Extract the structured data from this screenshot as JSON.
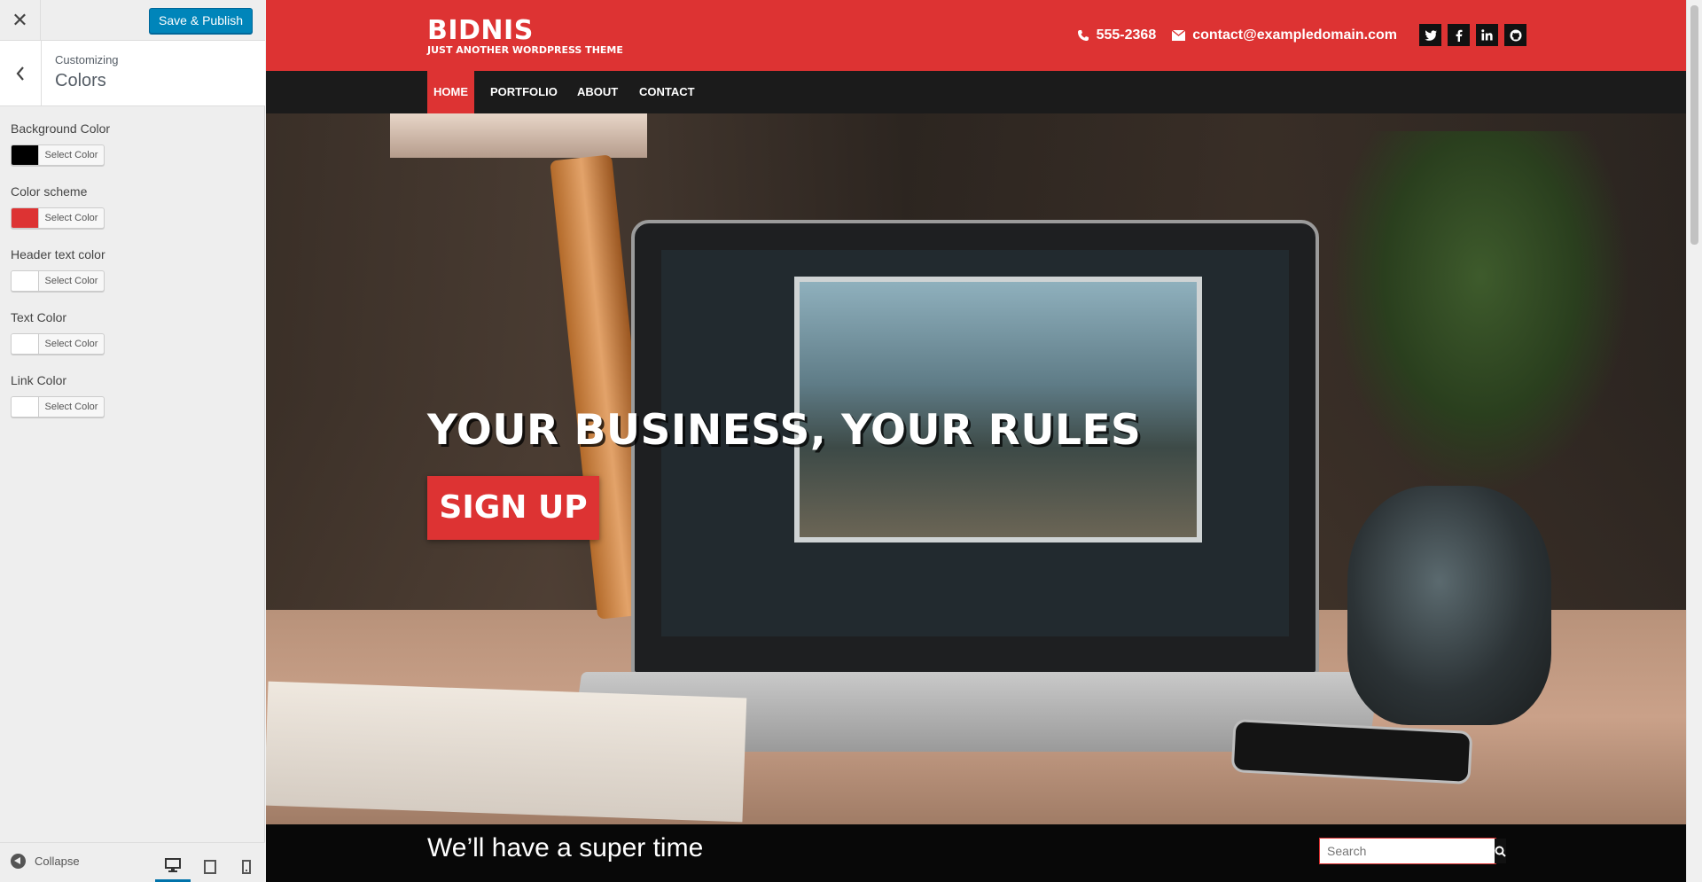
{
  "customizer": {
    "close_icon": "close-icon",
    "save_label": "Save & Publish",
    "customizing_label": "Customizing",
    "section_name": "Colors",
    "controls": [
      {
        "label": "Background Color",
        "color": "#000000",
        "button": "Select Color"
      },
      {
        "label": "Color scheme",
        "color": "#dd3333",
        "button": "Select Color"
      },
      {
        "label": "Header text color",
        "color": "#ffffff",
        "button": "Select Color"
      },
      {
        "label": "Text Color",
        "color": "#ffffff",
        "button": "Select Color"
      },
      {
        "label": "Link Color",
        "color": "#ffffff",
        "button": "Select Color"
      }
    ],
    "collapse_label": "Collapse",
    "devices": [
      "desktop-icon",
      "tablet-icon",
      "mobile-icon"
    ],
    "active_device": "desktop"
  },
  "site": {
    "brand_name": "BIDNIS",
    "tagline": "JUST ANOTHER WORDPRESS THEME",
    "phone": "555-2368",
    "email": "contact@exampledomain.com",
    "social": [
      "twitter-icon",
      "facebook-icon",
      "linkedin-icon",
      "github-icon"
    ],
    "nav": [
      {
        "label": "HOME",
        "active": true
      },
      {
        "label": "PORTFOLIO",
        "active": false
      },
      {
        "label": "ABOUT",
        "active": false
      },
      {
        "label": "CONTACT",
        "active": false
      }
    ],
    "hero_title": "YOUR BUSINESS, YOUR RULES",
    "hero_button": "SIGN UP",
    "content_heading": "We’ll have a super time",
    "search_placeholder": "Search",
    "colors": {
      "accent": "#dd3333",
      "nav_bg": "#1b1b1b",
      "wp_blue": "#0085ba"
    }
  }
}
